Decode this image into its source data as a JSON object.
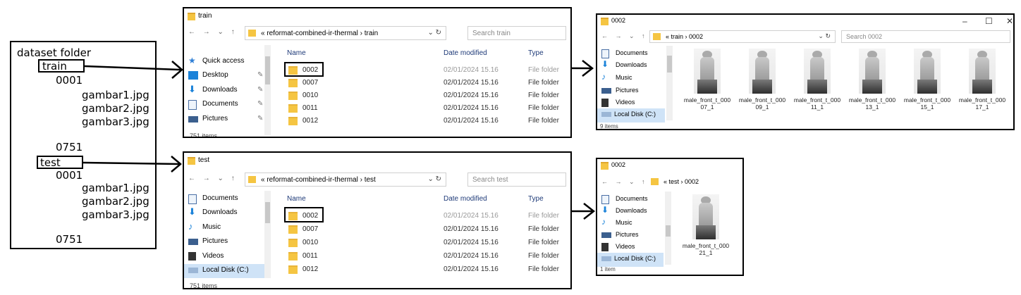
{
  "dataset": {
    "title": "dataset folder",
    "train": "train",
    "test": "test",
    "train_items": {
      "first": "0001",
      "files": [
        "gambar1.jpg",
        "gambar2.jpg",
        "gambar3.jpg"
      ],
      "last": "0751"
    },
    "test_items": {
      "first": "0001",
      "files": [
        "gambar1.jpg",
        "gambar2.jpg",
        "gambar3.jpg"
      ],
      "last": "0751"
    }
  },
  "train_window": {
    "title": "train",
    "address": "« reformat-combined-ir-thermal › train",
    "search_placeholder": "Search train",
    "nav": [
      "Quick access",
      "Desktop",
      "Downloads",
      "Documents",
      "Pictures"
    ],
    "headers": {
      "name": "Name",
      "date": "Date modified",
      "type": "Type"
    },
    "rows": [
      {
        "name": "0002",
        "date": "02/01/2024 15.16",
        "type": "File folder"
      },
      {
        "name": "0007",
        "date": "02/01/2024 15.16",
        "type": "File folder"
      },
      {
        "name": "0010",
        "date": "02/01/2024 15.16",
        "type": "File folder"
      },
      {
        "name": "0011",
        "date": "02/01/2024 15.16",
        "type": "File folder"
      },
      {
        "name": "0012",
        "date": "02/01/2024 15.16",
        "type": "File folder"
      }
    ],
    "status": "751 items"
  },
  "test_window": {
    "title": "test",
    "address": "« reformat-combined-ir-thermal › test",
    "search_placeholder": "Search test",
    "nav": [
      "Documents",
      "Downloads",
      "Music",
      "Pictures",
      "Videos",
      "Local Disk (C:)"
    ],
    "headers": {
      "name": "Name",
      "date": "Date modified",
      "type": "Type"
    },
    "rows": [
      {
        "name": "0002",
        "date": "02/01/2024 15.16",
        "type": "File folder"
      },
      {
        "name": "0007",
        "date": "02/01/2024 15.16",
        "type": "File folder"
      },
      {
        "name": "0010",
        "date": "02/01/2024 15.16",
        "type": "File folder"
      },
      {
        "name": "0011",
        "date": "02/01/2024 15.16",
        "type": "File folder"
      },
      {
        "name": "0012",
        "date": "02/01/2024 15.16",
        "type": "File folder"
      }
    ],
    "status": "751 items"
  },
  "train_0002_window": {
    "title": "0002",
    "address": "« train › 0002",
    "search_placeholder": "Search 0002",
    "nav": [
      "Documents",
      "Downloads",
      "Music",
      "Pictures",
      "Videos",
      "Local Disk (C:)"
    ],
    "files": [
      "male_front_t_00007_1",
      "male_front_t_00009_1",
      "male_front_t_00011_1",
      "male_front_t_00013_1",
      "male_front_t_00015_1",
      "male_front_t_00017_1"
    ],
    "captions": [
      [
        "male_front_t_000",
        "07_1"
      ],
      [
        "male_front_t_000",
        "09_1"
      ],
      [
        "male_front_t_000",
        "11_1"
      ],
      [
        "male_front_t_000",
        "13_1"
      ],
      [
        "male_front_t_000",
        "15_1"
      ],
      [
        "male_front_t_000",
        "17_1"
      ]
    ],
    "status": "9 items"
  },
  "test_0002_window": {
    "title": "0002",
    "address": "« test › 0002",
    "nav": [
      "Documents",
      "Downloads",
      "Music",
      "Pictures",
      "Videos",
      "Local Disk (C:)"
    ],
    "captions": [
      [
        "male_front_t_000",
        "21_1"
      ]
    ],
    "status": "1 item"
  },
  "colors": {
    "folder": "#f5c542",
    "header_text": "#1e3a78",
    "quick_access_star": "#2f7fd6"
  }
}
